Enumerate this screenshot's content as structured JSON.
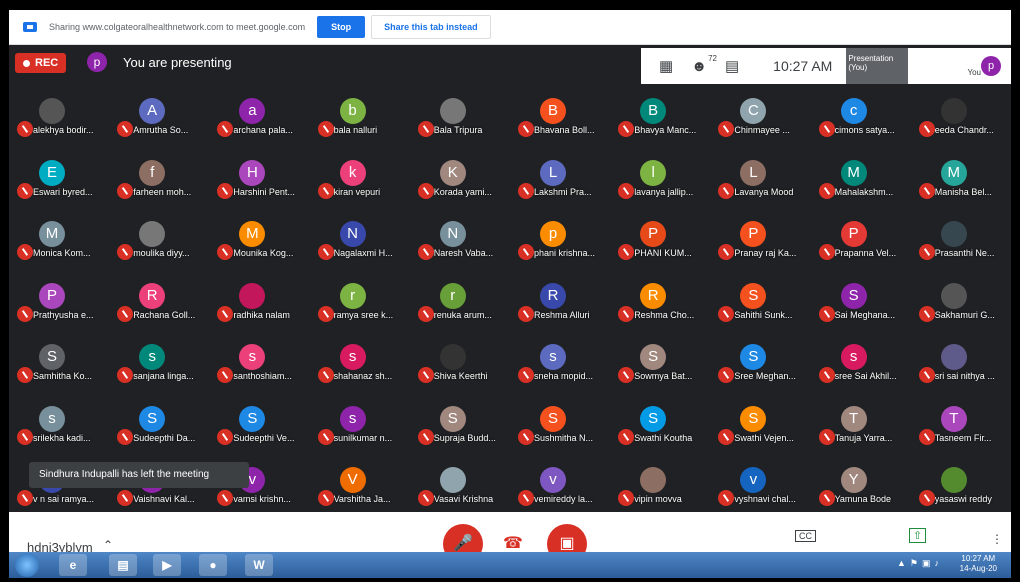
{
  "share_bar": {
    "message": "Sharing www.colgateoralhealthnetwork.com to meet.google.com",
    "stop_label": "Stop",
    "share_tab_label": "Share this tab instead"
  },
  "top_bar": {
    "rec_label": "REC",
    "presenter_initial": "p",
    "presenting_text": "You are presenting",
    "participant_count": "72",
    "time": "10:27 AM",
    "presentation_label": "Presentation (You)",
    "you_label": "You",
    "you_initial": "p"
  },
  "participants": [
    {
      "name": "alekhya bodir...",
      "initial": "",
      "color": "#555"
    },
    {
      "name": "Amrutha So...",
      "initial": "A",
      "color": "#5c6bc0"
    },
    {
      "name": "archana pala...",
      "initial": "a",
      "color": "#8e24aa"
    },
    {
      "name": "bala nalluri",
      "initial": "b",
      "color": "#7cb342"
    },
    {
      "name": "Bala Tripura",
      "initial": "",
      "color": "#777"
    },
    {
      "name": "Bhavana Boll...",
      "initial": "B",
      "color": "#f4511e"
    },
    {
      "name": "Bhavya Manc...",
      "initial": "B",
      "color": "#00897b"
    },
    {
      "name": "Chinmayee ...",
      "initial": "C",
      "color": "#90a4ae"
    },
    {
      "name": "cimons satya...",
      "initial": "c",
      "color": "#1e88e5"
    },
    {
      "name": "eeda Chandr...",
      "initial": "",
      "color": "#333"
    },
    {
      "name": "Eswari byred...",
      "initial": "E",
      "color": "#00acc1"
    },
    {
      "name": "farheen moh...",
      "initial": "f",
      "color": "#8d6e63"
    },
    {
      "name": "Harshini Pent...",
      "initial": "H",
      "color": "#ab47bc"
    },
    {
      "name": "kiran vepuri",
      "initial": "k",
      "color": "#ec407a"
    },
    {
      "name": "Korada yami...",
      "initial": "K",
      "color": "#a1887f"
    },
    {
      "name": "Lakshmi Pra...",
      "initial": "L",
      "color": "#5c6bc0"
    },
    {
      "name": "lavanya jallip...",
      "initial": "l",
      "color": "#7cb342"
    },
    {
      "name": "Lavanya Mood",
      "initial": "L",
      "color": "#8d6e63"
    },
    {
      "name": "Mahalakshm...",
      "initial": "M",
      "color": "#00897b"
    },
    {
      "name": "Manisha Bel...",
      "initial": "M",
      "color": "#26a69a"
    },
    {
      "name": "Monica Kom...",
      "initial": "M",
      "color": "#78909c"
    },
    {
      "name": "moulika diyy...",
      "initial": "",
      "color": "#777"
    },
    {
      "name": "Mounika Kog...",
      "initial": "M",
      "color": "#fb8c00"
    },
    {
      "name": "Nagalaxmi H...",
      "initial": "N",
      "color": "#3949ab"
    },
    {
      "name": "Naresh Vaba...",
      "initial": "N",
      "color": "#78909c"
    },
    {
      "name": "phani krishna...",
      "initial": "p",
      "color": "#fb8c00"
    },
    {
      "name": "PHANI KUM...",
      "initial": "P",
      "color": "#e64a19"
    },
    {
      "name": "Pranay raj Ka...",
      "initial": "P",
      "color": "#f4511e"
    },
    {
      "name": "Prapanna Vel...",
      "initial": "P",
      "color": "#e53935"
    },
    {
      "name": "Prasanthi Ne...",
      "initial": "",
      "color": "#37474f"
    },
    {
      "name": "Prathyusha e...",
      "initial": "P",
      "color": "#ab47bc"
    },
    {
      "name": "Rachana Goll...",
      "initial": "R",
      "color": "#ec407a"
    },
    {
      "name": "radhika nalam",
      "initial": "",
      "color": "#c2185b"
    },
    {
      "name": "ramya sree k...",
      "initial": "r",
      "color": "#7cb342"
    },
    {
      "name": "renuka arum...",
      "initial": "r",
      "color": "#689f38"
    },
    {
      "name": "Reshma Alluri",
      "initial": "R",
      "color": "#3949ab"
    },
    {
      "name": "Reshma Cho...",
      "initial": "R",
      "color": "#fb8c00"
    },
    {
      "name": "Sahithi Sunk...",
      "initial": "S",
      "color": "#f4511e"
    },
    {
      "name": "Sai Meghana...",
      "initial": "S",
      "color": "#8e24aa"
    },
    {
      "name": "Sakhamuri G...",
      "initial": "",
      "color": "#555"
    },
    {
      "name": "Samhitha Ko...",
      "initial": "S",
      "color": "#5f6368"
    },
    {
      "name": "sanjana linga...",
      "initial": "s",
      "color": "#00897b"
    },
    {
      "name": "santhoshiam...",
      "initial": "s",
      "color": "#ec407a"
    },
    {
      "name": "shahanaz sh...",
      "initial": "s",
      "color": "#d81b60"
    },
    {
      "name": "Shiva Keerthi",
      "initial": "",
      "color": "#333"
    },
    {
      "name": "sneha mopid...",
      "initial": "s",
      "color": "#5c6bc0"
    },
    {
      "name": "Sowmya Bat...",
      "initial": "S",
      "color": "#a1887f"
    },
    {
      "name": "Sree Meghan...",
      "initial": "S",
      "color": "#1e88e5"
    },
    {
      "name": "sree Sai Akhil...",
      "initial": "s",
      "color": "#d81b60"
    },
    {
      "name": "sri sai nithya ...",
      "initial": "",
      "color": "#5e5a8a"
    },
    {
      "name": "srilekha kadi...",
      "initial": "s",
      "color": "#78909c"
    },
    {
      "name": "Sudeepthi Da...",
      "initial": "S",
      "color": "#1e88e5"
    },
    {
      "name": "Sudeepthi Ve...",
      "initial": "S",
      "color": "#1e88e5"
    },
    {
      "name": "sunilkumar n...",
      "initial": "s",
      "color": "#8e24aa"
    },
    {
      "name": "Supraja Budd...",
      "initial": "S",
      "color": "#a1887f"
    },
    {
      "name": "Sushmitha N...",
      "initial": "S",
      "color": "#f4511e"
    },
    {
      "name": "Swathi Koutha",
      "initial": "S",
      "color": "#039be5"
    },
    {
      "name": "Swathi Vejen...",
      "initial": "S",
      "color": "#fb8c00"
    },
    {
      "name": "Tanuja Yarra...",
      "initial": "T",
      "color": "#a1887f"
    },
    {
      "name": "Tasneem Fir...",
      "initial": "T",
      "color": "#ab47bc"
    },
    {
      "name": "v n sai ramya...",
      "initial": "v",
      "color": "#3949ab"
    },
    {
      "name": "Vaishnavi Kal...",
      "initial": "V",
      "color": "#8e24aa"
    },
    {
      "name": "vamsi krishn...",
      "initial": "v",
      "color": "#8e24aa"
    },
    {
      "name": "Varshitha Ja...",
      "initial": "V",
      "color": "#ef6c00"
    },
    {
      "name": "Vasavi Krishna",
      "initial": "",
      "color": "#90a4ae"
    },
    {
      "name": "vemireddy la...",
      "initial": "v",
      "color": "#7e57c2"
    },
    {
      "name": "vipin movva",
      "initial": "",
      "color": "#8d6e63"
    },
    {
      "name": "vyshnavi chal...",
      "initial": "v",
      "color": "#1565c0"
    },
    {
      "name": "Yamuna Bode",
      "initial": "Y",
      "color": "#a1887f"
    },
    {
      "name": "yasaswi reddy",
      "initial": "",
      "color": "#558b2f"
    }
  ],
  "toast": "Sindhura Indupalli has left the meeting",
  "bottom_bar": {
    "meeting_code": "hdni3yblym",
    "cc_label": "CC"
  },
  "taskbar": {
    "word_label": "W",
    "clock_time": "10:27 AM",
    "clock_date": "14-Aug-20"
  }
}
